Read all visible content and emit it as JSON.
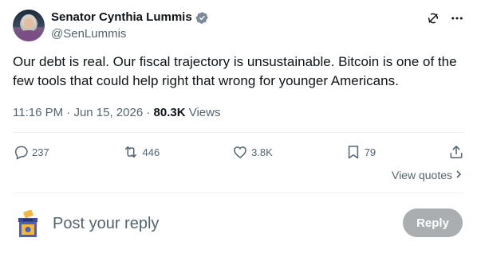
{
  "author": {
    "display_name": "Senator Cynthia Lummis",
    "handle": "@SenLummis"
  },
  "tweet": {
    "text": "Our debt is real. Our fiscal trajectory is unsustainable. Bitcoin is one of the few tools that could help right that wrong for younger Americans.",
    "time": "11:16 PM",
    "separator1": " · ",
    "date": "Jun 15, 2026",
    "separator2": " · ",
    "views_count": "80.3K",
    "views_label": "Views"
  },
  "actions": {
    "replies": "237",
    "reposts": "446",
    "likes": "3.8K",
    "bookmarks": "79"
  },
  "view_quotes_label": "View quotes",
  "reply": {
    "placeholder": "Post your reply",
    "button_label": "Reply"
  },
  "colors": {
    "text_primary": "#0f1419",
    "text_secondary": "#536471",
    "verified_blue": "#1d9bf0",
    "reply_button": "#8f9497",
    "divider": "#eff3f4"
  },
  "icons": [
    "verified-icon",
    "grok-icon",
    "more-icon",
    "reply-icon",
    "repost-icon",
    "like-icon",
    "bookmark-icon",
    "share-icon",
    "chevron-right-icon",
    "ballot-box-icon"
  ]
}
